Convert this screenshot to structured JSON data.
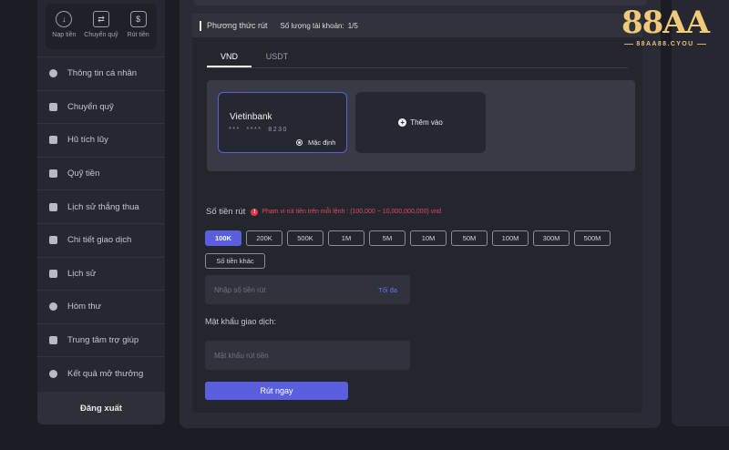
{
  "quick_actions": [
    {
      "label": "Nạp tiền",
      "icon": "deposit-icon",
      "glyph": "↓"
    },
    {
      "label": "Chuyển quỹ",
      "icon": "wallet-icon",
      "glyph": "⇄"
    },
    {
      "label": "Rút tiền",
      "icon": "withdraw-icon",
      "glyph": "$"
    }
  ],
  "menu": [
    {
      "label": "Thông tin cá nhân",
      "icon": "user-icon"
    },
    {
      "label": "Chuyển quỹ",
      "icon": "wallet-icon"
    },
    {
      "label": "Hũ tích lũy",
      "icon": "jar-icon"
    },
    {
      "label": "Quỹ tiền",
      "icon": "fund-icon"
    },
    {
      "label": "Lịch sử thắng thua",
      "icon": "history-icon"
    },
    {
      "label": "Chi tiết giao dịch",
      "icon": "transactions-icon"
    },
    {
      "label": "Lịch sử",
      "icon": "clock-icon"
    },
    {
      "label": "Hòm thư",
      "icon": "mail-icon"
    },
    {
      "label": "Trung tâm trợ giúp",
      "icon": "help-icon"
    },
    {
      "label": "Kết quả mở thưởng",
      "icon": "trophy-icon"
    }
  ],
  "logout_label": "Đăng xuất",
  "withdraw": {
    "section_title": "Phương thức rút",
    "account_count_label": "Số lượng tài khoản:",
    "account_count": "1/5",
    "tabs": [
      "VND",
      "USDT"
    ],
    "active_tab": "VND",
    "bank": {
      "name": "Vietinbank",
      "number": "***  ****  8230",
      "default_label": "Mặc định"
    },
    "add_label": "Thêm vào",
    "amount_label": "Số tiền rút",
    "range_text": "Phạm vi rút tiền trên mỗi lệnh : (100,000 ~ 10,000,000,000) vnd",
    "amounts": [
      "100K",
      "200K",
      "500K",
      "1M",
      "5M",
      "10M",
      "50M",
      "100M",
      "300M",
      "500M"
    ],
    "selected_amount": "100K",
    "other_amount_label": "Số tiền khác",
    "amount_placeholder": "Nhập số tiền rút",
    "max_label": "Tối đa",
    "password_label": "Mật khẩu giao dịch:",
    "password_placeholder": "Mật khẩu rút tiền",
    "submit_label": "Rút ngay"
  },
  "logo": {
    "main": "88AA",
    "sub": "88AA88.CYOU",
    "color": "#f1c978"
  },
  "colors": {
    "accent": "#5a5fe0",
    "warning": "#e5475b",
    "background": "#1c1d24"
  }
}
